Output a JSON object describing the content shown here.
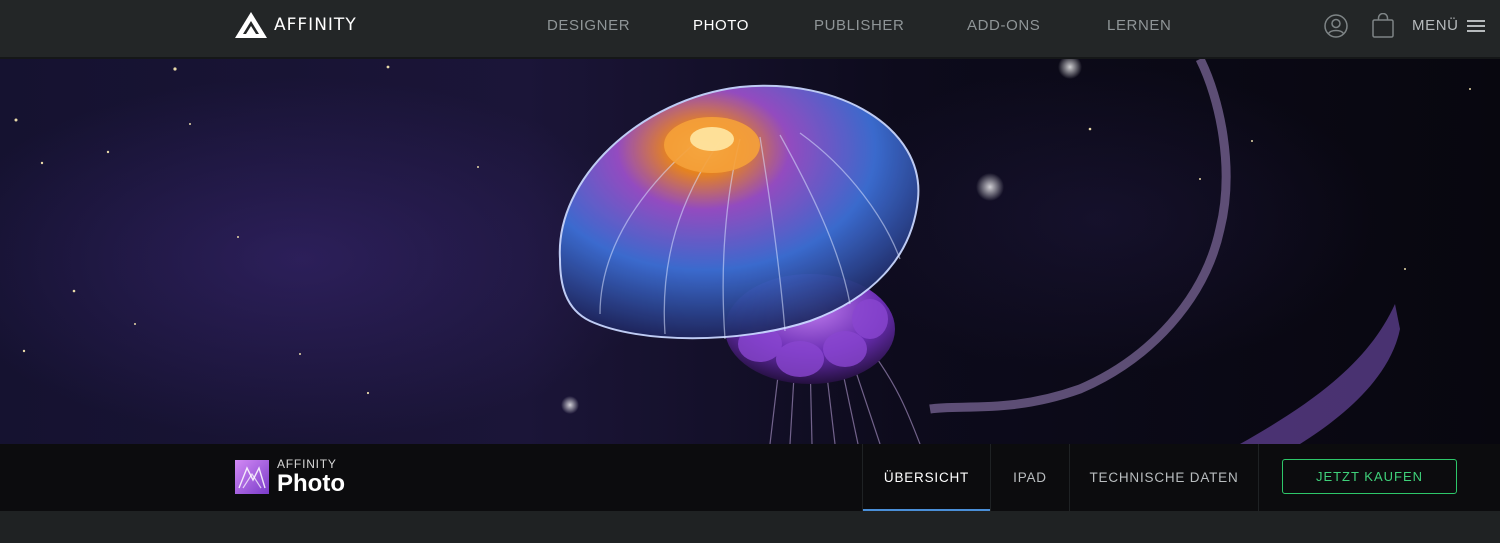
{
  "brand": {
    "logo_text": "AFFINITY"
  },
  "nav": {
    "items": [
      {
        "label": "DESIGNER",
        "active": false
      },
      {
        "label": "PHOTO",
        "active": true
      },
      {
        "label": "PUBLISHER",
        "active": false
      },
      {
        "label": "ADD-ONS",
        "active": false
      },
      {
        "label": "LERNEN",
        "active": false
      }
    ],
    "account_icon": "user-circle-icon",
    "cart_icon": "shopping-bag-icon",
    "menu_label": "MENÜ",
    "menu_icon": "hamburger-icon"
  },
  "hero": {
    "image": "jellyfish-in-space",
    "colors": {
      "bg_dark": "#08070f",
      "nebula": "#1b1538",
      "jelly_orange": "#f28a1e",
      "jelly_purple": "#7b3cc4",
      "jelly_blue": "#3d6fd6"
    }
  },
  "product": {
    "brand": "AFFINITY",
    "name": "Photo",
    "logo_icon": "affinity-photo-logo-icon"
  },
  "subnav": {
    "tabs": [
      {
        "label": "ÜBERSICHT",
        "active": true
      },
      {
        "label": "IPAD",
        "active": false
      },
      {
        "label": "TECHNISCHE DATEN",
        "active": false
      }
    ],
    "buy_label": "JETZT KAUFEN"
  },
  "colors": {
    "accent_green": "#2ec76a",
    "active_underline": "#4a8fd8",
    "nav_bg": "#232627"
  }
}
